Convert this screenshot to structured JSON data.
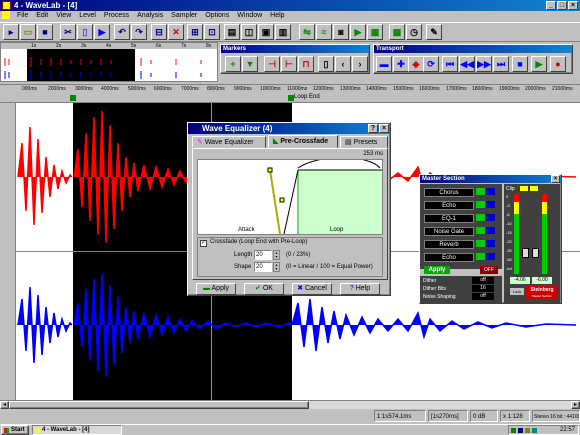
{
  "window": {
    "title": "4 - WaveLab - [4]"
  },
  "menu": [
    "File",
    "Edit",
    "View",
    "Level",
    "Process",
    "Analysis",
    "Sampler",
    "Options",
    "Window",
    "Help"
  ],
  "markers_panel": {
    "title": "Markers"
  },
  "transport_panel": {
    "title": "Transport"
  },
  "overview_ruler": [
    "1s",
    "2s",
    "3s",
    "4s",
    "5s",
    "6s",
    "7s",
    "8s"
  ],
  "main_ruler": [
    "000",
    "2000",
    "3000",
    "4000",
    "5000",
    "6000",
    "7000",
    "8000",
    "9000",
    "10000",
    "11000",
    "12000",
    "13000",
    "14000",
    "15000",
    "16000",
    "17000",
    "18000",
    "19000",
    "20000",
    "21000"
  ],
  "ruler_unit": "ms",
  "loop_end_label": "Loop End",
  "channel_colors": {
    "left": "#ff0000",
    "right": "#0000ff",
    "loop_region": "#000000",
    "background": "#ffffff"
  },
  "status": {
    "cursor": "1:1s574.1ms",
    "range": "[1s270ms]",
    "level": "0 dB",
    "zoom": "x 1:128",
    "format": "Stereo 16 bit : 44100 Hz"
  },
  "taskbar": {
    "start": "Start",
    "app": "4 - WaveLab - [4]",
    "clock": "22:57"
  },
  "equalizer": {
    "title": "Wave Equalizer (4)",
    "tabs": [
      "Wave Equalizer",
      "Pre-Crossfade",
      "Presets"
    ],
    "active_tab": "Pre-Crossfade",
    "time": "253 ms",
    "graph_attack": "Attack",
    "graph_loop": "Loop",
    "crossfade_label": "Crossfade (Loop End with Pre-Loop)",
    "crossfade_checked": true,
    "length_label": "Length",
    "length_value": "20",
    "length_hint": "(0 / 23%)",
    "shape_label": "Shape",
    "shape_value": "20",
    "shape_hint": "(0 = Linear / 100 = Equal Power)",
    "buttons": {
      "apply": "Apply",
      "ok": "OK",
      "cancel": "Cancel",
      "help": "Help"
    }
  },
  "master": {
    "title": "Master Section",
    "effects": [
      "Chorus",
      "Echo",
      "EQ-1",
      "Noise Gate",
      "Reverb",
      "Echo"
    ],
    "apply": "Apply",
    "off": "OFF",
    "dither_label": "Dither",
    "dither_bits_label": "Dither Bits",
    "noise_shaping_label": "Noise Shaping",
    "dither_value": "off",
    "dither_bits_value": "16",
    "noise_shaping_value": "off",
    "meter_scale": [
      "Clip",
      "0",
      "-3",
      "-6",
      "-10",
      "-15",
      "-20",
      "-30",
      "-50",
      "-inf"
    ],
    "meter_readout": [
      "-4.06",
      "-6.00"
    ],
    "lock": "Lock",
    "brand": "Steinberg",
    "brand_sub": "Master Section"
  }
}
